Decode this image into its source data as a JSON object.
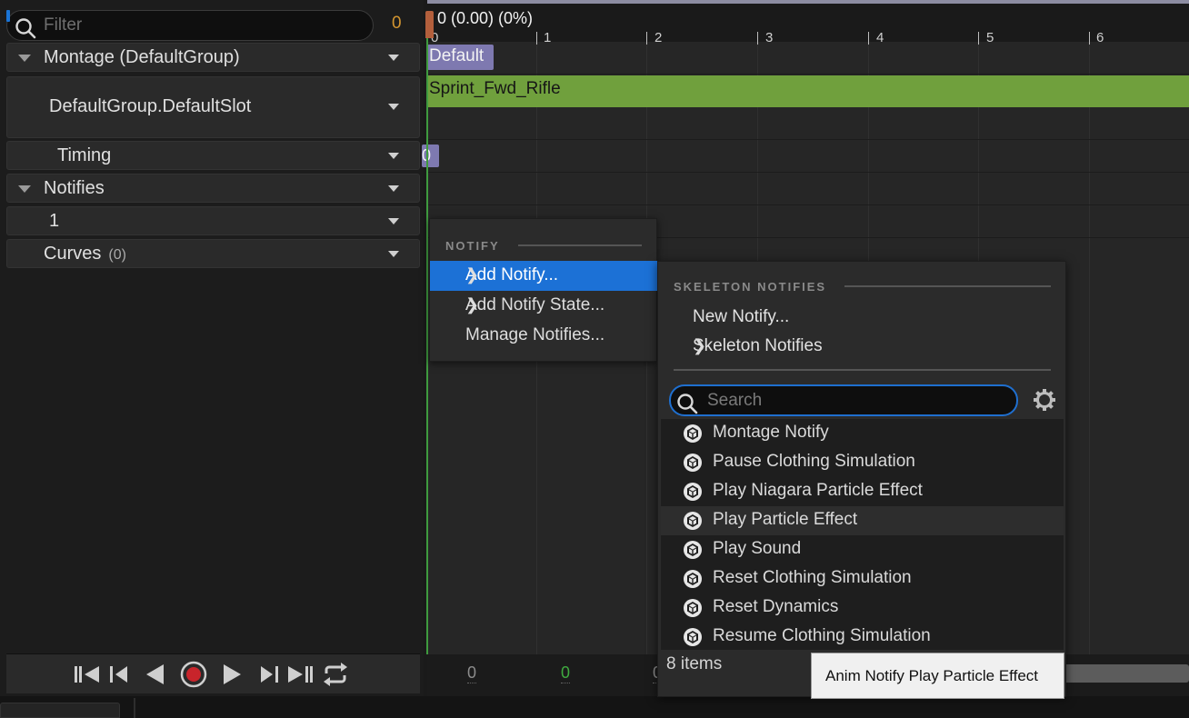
{
  "left_panel": {
    "filter_placeholder": "Filter",
    "filter_count": "0",
    "rows": {
      "montage": "Montage (DefaultGroup)",
      "slot": "DefaultGroup.DefaultSlot",
      "timing": "Timing",
      "notifies": "Notifies",
      "notify_track": "1",
      "curves": "Curves",
      "curves_count": "(0)"
    }
  },
  "timeline": {
    "frame_info": "0 (0.00) (0%)",
    "ticks": [
      "0",
      "1",
      "2",
      "3",
      "4",
      "5",
      "6"
    ],
    "section_label": "Default",
    "segment_label": "Sprint_Fwd_Rifle",
    "notify_badge": "0",
    "bottom_values": {
      "start": "0",
      "current": "0",
      "end": "0"
    }
  },
  "menu_notify": {
    "section": "NOTIFY",
    "items": [
      {
        "label": "Add Notify..."
      },
      {
        "label": "Add Notify State..."
      },
      {
        "label": "Manage Notifies..."
      }
    ]
  },
  "menu_skeleton": {
    "section": "SKELETON NOTIFIES",
    "new_notify": "New Notify...",
    "skeleton_notifies": "Skeleton Notifies",
    "search_placeholder": "Search",
    "items": [
      "Montage Notify",
      "Pause Clothing Simulation",
      "Play Niagara Particle Effect",
      "Play Particle Effect",
      "Play Sound",
      "Reset Clothing Simulation",
      "Reset Dynamics",
      "Resume Clothing Simulation"
    ],
    "item_count": "8 items"
  },
  "tooltip": "Anim Notify Play Particle Effect",
  "colors": {
    "accent_blue": "#1c71d6",
    "segment_green": "#70a03d",
    "section_purple": "#7e79b0",
    "filter_count": "#d39530",
    "current_frame_green": "#3faa3f"
  }
}
